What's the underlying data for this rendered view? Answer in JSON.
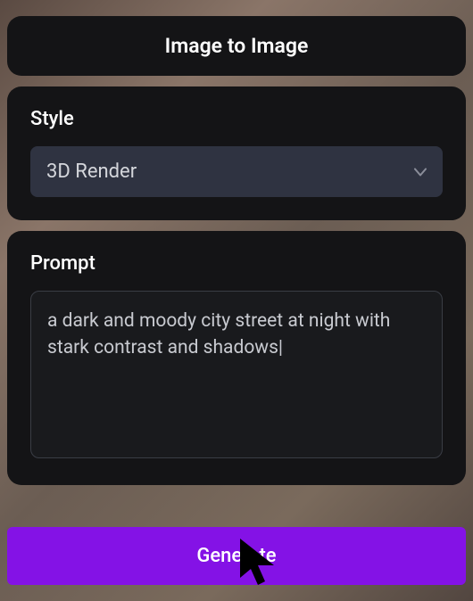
{
  "header": {
    "title": "Image to Image"
  },
  "style": {
    "label": "Style",
    "selected": "3D Render"
  },
  "prompt": {
    "label": "Prompt",
    "value": "a dark and moody city street at night with stark contrast and shadows|"
  },
  "generate": {
    "label": "Generate"
  }
}
